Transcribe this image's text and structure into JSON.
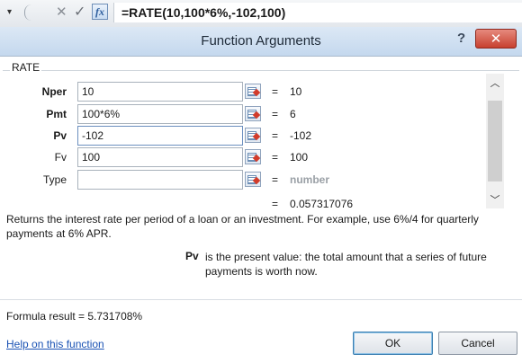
{
  "formula_bar": {
    "dropdown_glyph": "▾",
    "cancel_glyph": "✕",
    "enter_glyph": "✓",
    "fx_label": "fx",
    "formula": "=RATE(10,100*6%,-102,100)"
  },
  "dialog": {
    "title": "Function Arguments",
    "help_glyph": "?",
    "close_glyph": "✕",
    "function_name": "RATE",
    "arguments": [
      {
        "name": "Nper",
        "value": "10",
        "eq": "=",
        "result": "10",
        "required": true
      },
      {
        "name": "Pmt",
        "value": "100*6%",
        "eq": "=",
        "result": "6",
        "required": true
      },
      {
        "name": "Pv",
        "value": "-102",
        "eq": "=",
        "result": "-102",
        "required": true
      },
      {
        "name": "Fv",
        "value": "100",
        "eq": "=",
        "result": "100",
        "required": false
      },
      {
        "name": "Type",
        "value": "",
        "eq": "=",
        "result": "number",
        "required": false
      }
    ],
    "overall_eq": "=",
    "overall_value": "0.057317076",
    "description": "Returns the interest rate per period of a loan or an investment. For example, use 6%/4 for quarterly payments at 6% APR.",
    "arg_help_name": "Pv",
    "arg_help_text": "is the present value: the total amount that a series of future payments is worth now.",
    "formula_result": "Formula result =   5.731708%",
    "help_link": "Help on this function",
    "ok_label": "OK",
    "cancel_label": "Cancel"
  }
}
